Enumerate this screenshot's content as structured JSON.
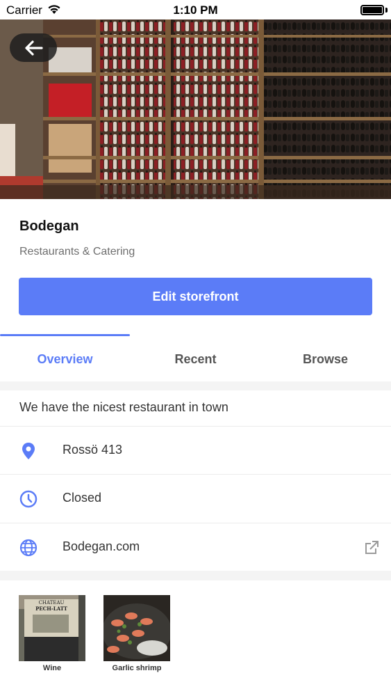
{
  "status_bar": {
    "carrier": "Carrier",
    "time": "1:10 PM"
  },
  "store": {
    "name": "Bodegan",
    "category": "Restaurants & Catering",
    "edit_label": "Edit storefront"
  },
  "tabs": [
    {
      "label": "Overview",
      "active": true
    },
    {
      "label": "Recent",
      "active": false
    },
    {
      "label": "Browse",
      "active": false
    }
  ],
  "overview": {
    "description": "We have the nicest restaurant in town",
    "address": "Rossö 413",
    "hours": "Closed",
    "website": "Bodegan.com"
  },
  "gallery": [
    {
      "caption": "Wine",
      "label": "CHATEAU PECH-LATT"
    },
    {
      "caption": "Garlic shrimp"
    }
  ],
  "colors": {
    "accent": "#5b7cf7"
  }
}
